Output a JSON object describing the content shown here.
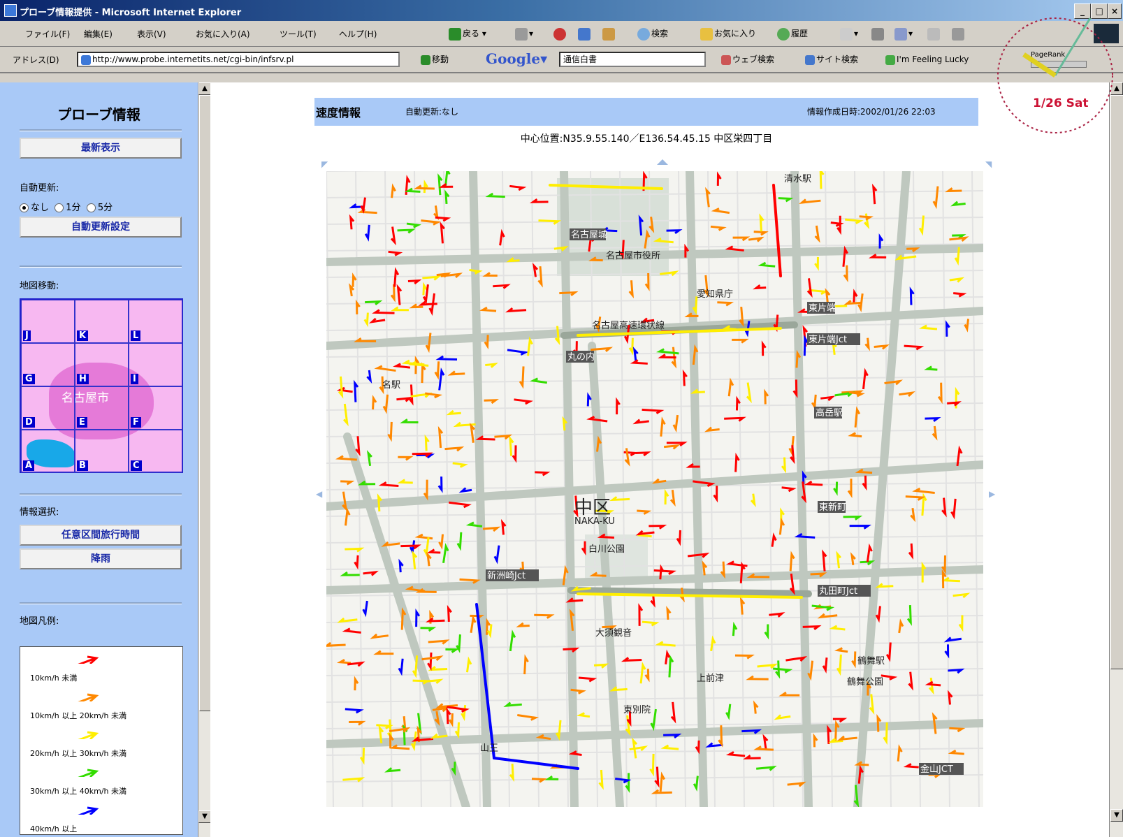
{
  "window": {
    "title": "プローブ情報提供 - Microsoft Internet Explorer"
  },
  "menubar": {
    "items": [
      "ファイル(F)",
      "編集(E)",
      "表示(V)",
      "お気に入り(A)",
      "ツール(T)",
      "ヘルプ(H)"
    ],
    "back": "戻る",
    "search": "検索",
    "favorites": "お気に入り",
    "history": "履歴"
  },
  "addressbar": {
    "label": "アドレス(D)",
    "url": "http://www.probe.internetits.net/cgi-bin/infsrv.pl",
    "go": "移動",
    "google_query": "通信白書",
    "web_search": "ウェブ検索",
    "site_search": "サイト検索",
    "lucky": "I'm Feeling Lucky",
    "pagerank": "PageRank"
  },
  "clock": {
    "date": "1/26 Sat"
  },
  "left": {
    "title": "プローブ情報",
    "latest_button": "最新表示",
    "auto_update_label": "自動更新:",
    "radio_options": [
      "なし",
      "1分",
      "5分"
    ],
    "auto_update_button": "自動更新設定",
    "map_move_label": "地図移動:",
    "map_city": "名古屋市",
    "grid": [
      "J",
      "K",
      "L",
      "G",
      "H",
      "I",
      "D",
      "E",
      "F",
      "A",
      "B",
      "C"
    ],
    "info_select_label": "情報選択:",
    "travel_time_button": "任意区間旅行時間",
    "rain_button": "降雨",
    "legend_label": "地図凡例:",
    "legend": [
      {
        "text": "10km/h 未満",
        "color": "#ff0000"
      },
      {
        "text": "10km/h 以上 20km/h 未満",
        "color": "#ff8800"
      },
      {
        "text": "20km/h 以上 30km/h 未満",
        "color": "#ffee00"
      },
      {
        "text": "30km/h 以上 40km/h 未満",
        "color": "#33dd00"
      },
      {
        "text": "40km/h 以上",
        "color": "#0000ff"
      }
    ]
  },
  "main": {
    "header_title": "速度情報",
    "auto_update": "自動更新:なし",
    "created": "情報作成日時:2002/01/26 22:03",
    "center_position": "中心位置:N35.9.55.140／E136.54.45.15 中区栄四丁目"
  },
  "map": {
    "labels": [
      "名古屋城",
      "名古屋市役所",
      "愛知県庁",
      "中区",
      "NAKA-KU",
      "白川公園",
      "丸の内",
      "東片端",
      "東片端Jct",
      "新洲崎Jct",
      "丸田町Jct",
      "鶴舞公園",
      "東別院",
      "高岳駅",
      "東新町",
      "名古屋高速環状線",
      "大須観音",
      "上前津",
      "鶴舞駅",
      "清水駅",
      "名駅",
      "山王",
      "金山JCT"
    ]
  }
}
